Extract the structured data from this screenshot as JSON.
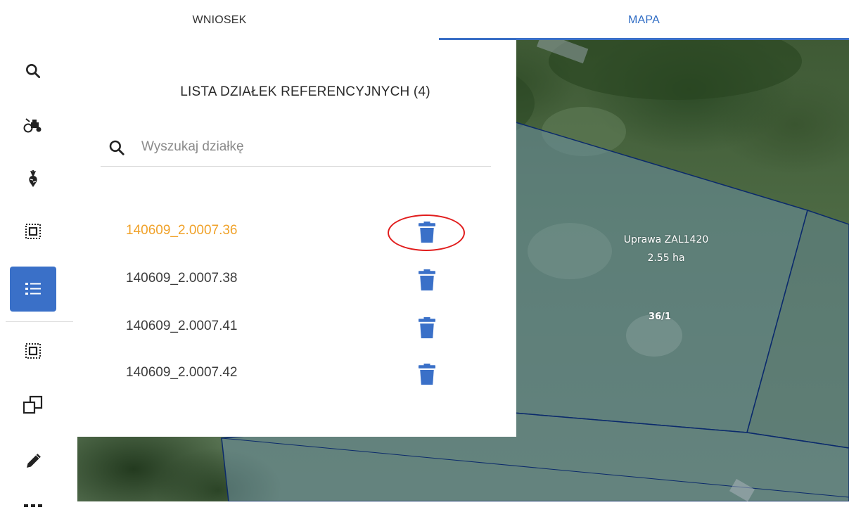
{
  "tabs": [
    {
      "label": "WNIOSEK",
      "active": false
    },
    {
      "label": "MAPA",
      "active": true
    }
  ],
  "accent_color": "#3a70c8",
  "toolbar": {
    "tools": [
      {
        "icon": "search-icon",
        "active": false
      },
      {
        "icon": "tractor-icon",
        "active": false
      },
      {
        "icon": "crop-plant-icon",
        "active": false
      },
      {
        "icon": "parcel-select-icon",
        "active": false
      },
      {
        "icon": "list-icon",
        "active": true
      },
      {
        "icon": "parcel-select-icon",
        "active": false
      },
      {
        "icon": "copy-icon",
        "active": false
      },
      {
        "icon": "pencil-icon",
        "active": false
      }
    ]
  },
  "panel": {
    "title": "LISTA DZIAŁEK REFERENCYJNYCH (4)",
    "search_placeholder": "Wyszukaj działkę",
    "parcels": [
      {
        "id": "140609_2.0007.36",
        "selected": true
      },
      {
        "id": "140609_2.0007.38",
        "selected": false
      },
      {
        "id": "140609_2.0007.41",
        "selected": false
      },
      {
        "id": "140609_2.0007.42",
        "selected": false
      }
    ]
  },
  "map": {
    "crop_name": "Uprawa ZAL1420",
    "crop_area": "2.55 ha",
    "parcel_label": "36/1"
  }
}
